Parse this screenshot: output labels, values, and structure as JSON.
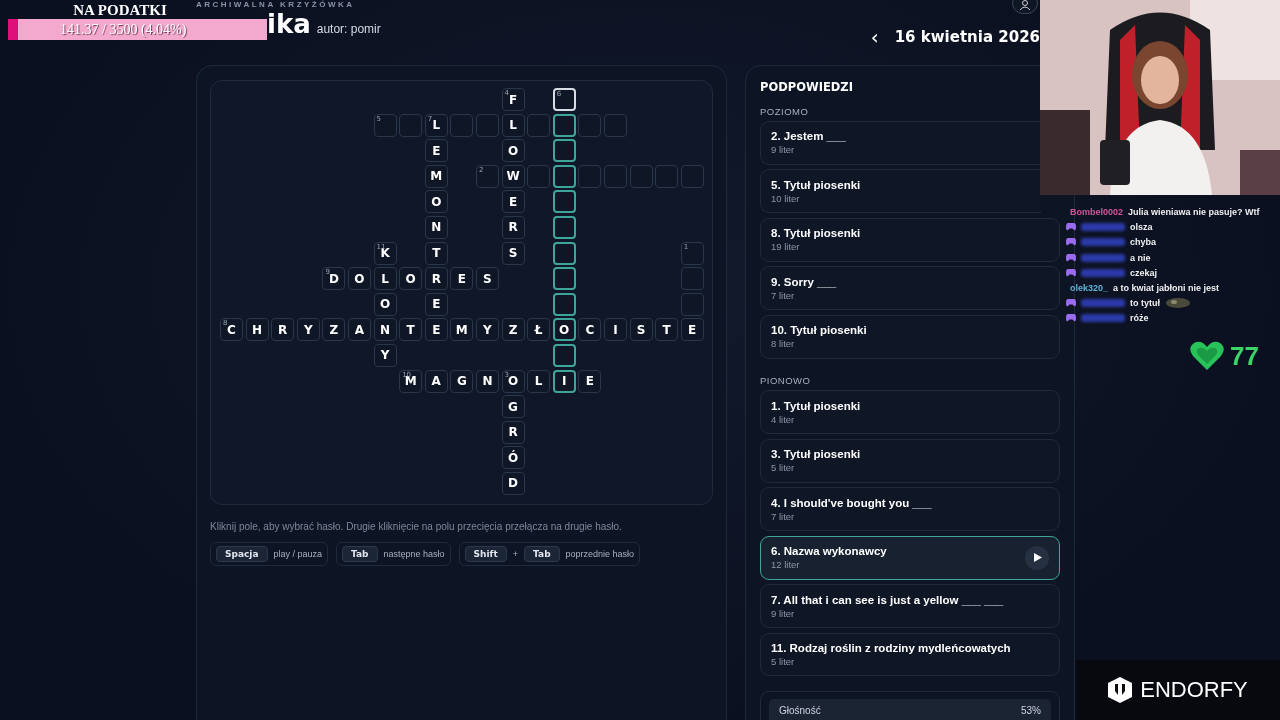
{
  "header": {
    "kicker": "ARCHIWALNA KRZYŻÓWKA",
    "title": "ika",
    "author": "autor: pomir",
    "date": "16 kwietnia 2026",
    "prev": "‹"
  },
  "donation": {
    "title": "NA PODATKI",
    "reading": "141.37 / 3500 (4.04%)",
    "level": 0.0404
  },
  "grid": {
    "rows": [
      {
        "cells": [
          {
            "kind": "gap"
          },
          {
            "kind": "gap"
          },
          {
            "kind": "gap"
          },
          {
            "kind": "gap"
          },
          {
            "kind": "gap"
          },
          {
            "kind": "gap"
          },
          {
            "kind": "gap"
          },
          {
            "kind": "gap"
          },
          {
            "kind": "gap"
          },
          {
            "kind": "gap"
          },
          {
            "kind": "gap"
          },
          {
            "kind": "cell",
            "letter": "F",
            "number": "4",
            "highlighted": false,
            "selected": false
          },
          {
            "kind": "gap"
          },
          {
            "kind": "cell",
            "number": "6",
            "highlighted": false,
            "selected": true
          }
        ]
      },
      {
        "cells": [
          {
            "kind": "gap"
          },
          {
            "kind": "gap"
          },
          {
            "kind": "gap"
          },
          {
            "kind": "gap"
          },
          {
            "kind": "gap"
          },
          {
            "kind": "gap"
          },
          {
            "kind": "cell",
            "number": "5",
            "highlighted": false,
            "selected": false
          },
          {
            "kind": "cell",
            "highlighted": false,
            "selected": false
          },
          {
            "kind": "cell",
            "letter": "L",
            "number": "7",
            "highlighted": false,
            "selected": false
          },
          {
            "kind": "cell",
            "highlighted": false,
            "selected": false
          },
          {
            "kind": "cell",
            "highlighted": false,
            "selected": false
          },
          {
            "kind": "cell",
            "letter": "L",
            "highlighted": false,
            "selected": false
          },
          {
            "kind": "cell",
            "highlighted": false,
            "selected": false
          },
          {
            "kind": "cell",
            "highlighted": true,
            "selected": false
          },
          {
            "kind": "cell",
            "highlighted": false,
            "selected": false
          },
          {
            "kind": "cell",
            "highlighted": false,
            "selected": false
          }
        ]
      },
      {
        "cells": [
          {
            "kind": "gap"
          },
          {
            "kind": "gap"
          },
          {
            "kind": "gap"
          },
          {
            "kind": "gap"
          },
          {
            "kind": "gap"
          },
          {
            "kind": "gap"
          },
          {
            "kind": "gap"
          },
          {
            "kind": "gap"
          },
          {
            "kind": "cell",
            "letter": "E",
            "highlighted": false,
            "selected": false
          },
          {
            "kind": "gap"
          },
          {
            "kind": "gap"
          },
          {
            "kind": "cell",
            "letter": "O",
            "highlighted": false,
            "selected": false
          },
          {
            "kind": "gap"
          },
          {
            "kind": "cell",
            "highlighted": true,
            "selected": false
          }
        ]
      },
      {
        "cells": [
          {
            "kind": "gap"
          },
          {
            "kind": "gap"
          },
          {
            "kind": "gap"
          },
          {
            "kind": "gap"
          },
          {
            "kind": "gap"
          },
          {
            "kind": "gap"
          },
          {
            "kind": "gap"
          },
          {
            "kind": "gap"
          },
          {
            "kind": "cell",
            "letter": "M",
            "highlighted": false,
            "selected": false
          },
          {
            "kind": "gap"
          },
          {
            "kind": "cell",
            "number": "2",
            "highlighted": false,
            "selected": false
          },
          {
            "kind": "cell",
            "letter": "W",
            "highlighted": false,
            "selected": false
          },
          {
            "kind": "cell",
            "highlighted": false,
            "selected": false
          },
          {
            "kind": "cell",
            "highlighted": true,
            "selected": false
          },
          {
            "kind": "cell",
            "highlighted": false,
            "selected": false
          },
          {
            "kind": "cell",
            "highlighted": false,
            "selected": false
          },
          {
            "kind": "cell",
            "highlighted": false,
            "selected": false
          },
          {
            "kind": "cell",
            "highlighted": false,
            "selected": false
          },
          {
            "kind": "cell",
            "highlighted": false,
            "selected": false
          }
        ]
      },
      {
        "cells": [
          {
            "kind": "gap"
          },
          {
            "kind": "gap"
          },
          {
            "kind": "gap"
          },
          {
            "kind": "gap"
          },
          {
            "kind": "gap"
          },
          {
            "kind": "gap"
          },
          {
            "kind": "gap"
          },
          {
            "kind": "gap"
          },
          {
            "kind": "cell",
            "letter": "O",
            "highlighted": false,
            "selected": false
          },
          {
            "kind": "gap"
          },
          {
            "kind": "gap"
          },
          {
            "kind": "cell",
            "letter": "E",
            "highlighted": false,
            "selected": false
          },
          {
            "kind": "gap"
          },
          {
            "kind": "cell",
            "highlighted": true,
            "selected": false
          }
        ]
      },
      {
        "cells": [
          {
            "kind": "gap"
          },
          {
            "kind": "gap"
          },
          {
            "kind": "gap"
          },
          {
            "kind": "gap"
          },
          {
            "kind": "gap"
          },
          {
            "kind": "gap"
          },
          {
            "kind": "gap"
          },
          {
            "kind": "gap"
          },
          {
            "kind": "cell",
            "letter": "N",
            "highlighted": false,
            "selected": false
          },
          {
            "kind": "gap"
          },
          {
            "kind": "gap"
          },
          {
            "kind": "cell",
            "letter": "R",
            "highlighted": false,
            "selected": false
          },
          {
            "kind": "gap"
          },
          {
            "kind": "cell",
            "highlighted": true,
            "selected": false
          }
        ]
      },
      {
        "cells": [
          {
            "kind": "gap"
          },
          {
            "kind": "gap"
          },
          {
            "kind": "gap"
          },
          {
            "kind": "gap"
          },
          {
            "kind": "gap"
          },
          {
            "kind": "gap"
          },
          {
            "kind": "cell",
            "letter": "K",
            "number": "11",
            "highlighted": false,
            "selected": false
          },
          {
            "kind": "gap"
          },
          {
            "kind": "cell",
            "letter": "T",
            "highlighted": false,
            "selected": false
          },
          {
            "kind": "gap"
          },
          {
            "kind": "gap"
          },
          {
            "kind": "cell",
            "letter": "S",
            "highlighted": false,
            "selected": false
          },
          {
            "kind": "gap"
          },
          {
            "kind": "cell",
            "highlighted": true,
            "selected": false
          },
          {
            "kind": "gap"
          },
          {
            "kind": "gap"
          },
          {
            "kind": "gap"
          },
          {
            "kind": "gap"
          },
          {
            "kind": "cell",
            "number": "1",
            "highlighted": false,
            "selected": false
          }
        ]
      },
      {
        "cells": [
          {
            "kind": "gap"
          },
          {
            "kind": "gap"
          },
          {
            "kind": "gap"
          },
          {
            "kind": "gap"
          },
          {
            "kind": "cell",
            "letter": "D",
            "number": "9",
            "highlighted": false,
            "selected": false
          },
          {
            "kind": "cell",
            "letter": "O",
            "highlighted": false,
            "selected": false
          },
          {
            "kind": "cell",
            "letter": "L",
            "highlighted": false,
            "selected": false
          },
          {
            "kind": "cell",
            "letter": "O",
            "highlighted": false,
            "selected": false
          },
          {
            "kind": "cell",
            "letter": "R",
            "highlighted": false,
            "selected": false
          },
          {
            "kind": "cell",
            "letter": "E",
            "highlighted": false,
            "selected": false
          },
          {
            "kind": "cell",
            "letter": "S",
            "highlighted": false,
            "selected": false
          },
          {
            "kind": "gap"
          },
          {
            "kind": "gap"
          },
          {
            "kind": "cell",
            "highlighted": true,
            "selected": false
          },
          {
            "kind": "gap"
          },
          {
            "kind": "gap"
          },
          {
            "kind": "gap"
          },
          {
            "kind": "gap"
          },
          {
            "kind": "cell",
            "highlighted": false,
            "selected": false
          }
        ]
      },
      {
        "cells": [
          {
            "kind": "gap"
          },
          {
            "kind": "gap"
          },
          {
            "kind": "gap"
          },
          {
            "kind": "gap"
          },
          {
            "kind": "gap"
          },
          {
            "kind": "gap"
          },
          {
            "kind": "cell",
            "letter": "O",
            "highlighted": false,
            "selected": false
          },
          {
            "kind": "gap"
          },
          {
            "kind": "cell",
            "letter": "E",
            "highlighted": false,
            "selected": false
          },
          {
            "kind": "gap"
          },
          {
            "kind": "gap"
          },
          {
            "kind": "gap"
          },
          {
            "kind": "gap"
          },
          {
            "kind": "cell",
            "highlighted": true,
            "selected": false
          },
          {
            "kind": "gap"
          },
          {
            "kind": "gap"
          },
          {
            "kind": "gap"
          },
          {
            "kind": "gap"
          },
          {
            "kind": "cell",
            "highlighted": false,
            "selected": false
          }
        ]
      },
      {
        "cells": [
          {
            "kind": "cell",
            "letter": "C",
            "number": "8",
            "highlighted": false,
            "selected": false
          },
          {
            "kind": "cell",
            "letter": "H",
            "highlighted": false,
            "selected": false
          },
          {
            "kind": "cell",
            "letter": "R",
            "highlighted": false,
            "selected": false
          },
          {
            "kind": "cell",
            "letter": "Y",
            "highlighted": false,
            "selected": false
          },
          {
            "kind": "cell",
            "letter": "Z",
            "highlighted": false,
            "selected": false
          },
          {
            "kind": "cell",
            "letter": "A",
            "highlighted": false,
            "selected": false
          },
          {
            "kind": "cell",
            "letter": "N",
            "highlighted": false,
            "selected": false
          },
          {
            "kind": "cell",
            "letter": "T",
            "highlighted": false,
            "selected": false
          },
          {
            "kind": "cell",
            "letter": "E",
            "highlighted": false,
            "selected": false
          },
          {
            "kind": "cell",
            "letter": "M",
            "highlighted": false,
            "selected": false
          },
          {
            "kind": "cell",
            "letter": "Y",
            "highlighted": false,
            "selected": false
          },
          {
            "kind": "cell",
            "letter": "Z",
            "highlighted": false,
            "selected": false
          },
          {
            "kind": "cell",
            "letter": "Ł",
            "highlighted": false,
            "selected": false
          },
          {
            "kind": "cell",
            "letter": "O",
            "highlighted": true,
            "selected": false
          },
          {
            "kind": "cell",
            "letter": "C",
            "highlighted": false,
            "selected": false
          },
          {
            "kind": "cell",
            "letter": "I",
            "highlighted": false,
            "selected": false
          },
          {
            "kind": "cell",
            "letter": "S",
            "highlighted": false,
            "selected": false
          },
          {
            "kind": "cell",
            "letter": "T",
            "highlighted": false,
            "selected": false
          },
          {
            "kind": "cell",
            "letter": "E",
            "highlighted": false,
            "selected": false
          }
        ]
      },
      {
        "cells": [
          {
            "kind": "gap"
          },
          {
            "kind": "gap"
          },
          {
            "kind": "gap"
          },
          {
            "kind": "gap"
          },
          {
            "kind": "gap"
          },
          {
            "kind": "gap"
          },
          {
            "kind": "cell",
            "letter": "Y",
            "highlighted": false,
            "selected": false
          },
          {
            "kind": "gap"
          },
          {
            "kind": "gap"
          },
          {
            "kind": "gap"
          },
          {
            "kind": "gap"
          },
          {
            "kind": "gap"
          },
          {
            "kind": "gap"
          },
          {
            "kind": "cell",
            "highlighted": true,
            "selected": false
          }
        ]
      },
      {
        "cells": [
          {
            "kind": "gap"
          },
          {
            "kind": "gap"
          },
          {
            "kind": "gap"
          },
          {
            "kind": "gap"
          },
          {
            "kind": "gap"
          },
          {
            "kind": "gap"
          },
          {
            "kind": "gap"
          },
          {
            "kind": "cell",
            "letter": "M",
            "number": "10",
            "highlighted": false,
            "selected": false
          },
          {
            "kind": "cell",
            "letter": "A",
            "highlighted": false,
            "selected": false
          },
          {
            "kind": "cell",
            "letter": "G",
            "highlighted": false,
            "selected": false
          },
          {
            "kind": "cell",
            "letter": "N",
            "highlighted": false,
            "selected": false
          },
          {
            "kind": "cell",
            "letter": "O",
            "number": "3",
            "highlighted": false,
            "selected": false
          },
          {
            "kind": "cell",
            "letter": "L",
            "highlighted": false,
            "selected": false
          },
          {
            "kind": "cell",
            "letter": "I",
            "highlighted": true,
            "selected": false
          },
          {
            "kind": "cell",
            "letter": "E",
            "highlighted": false,
            "selected": false
          }
        ]
      },
      {
        "cells": [
          {
            "kind": "gap"
          },
          {
            "kind": "gap"
          },
          {
            "kind": "gap"
          },
          {
            "kind": "gap"
          },
          {
            "kind": "gap"
          },
          {
            "kind": "gap"
          },
          {
            "kind": "gap"
          },
          {
            "kind": "gap"
          },
          {
            "kind": "gap"
          },
          {
            "kind": "gap"
          },
          {
            "kind": "gap"
          },
          {
            "kind": "cell",
            "letter": "G",
            "highlighted": false,
            "selected": false
          }
        ]
      },
      {
        "cells": [
          {
            "kind": "gap"
          },
          {
            "kind": "gap"
          },
          {
            "kind": "gap"
          },
          {
            "kind": "gap"
          },
          {
            "kind": "gap"
          },
          {
            "kind": "gap"
          },
          {
            "kind": "gap"
          },
          {
            "kind": "gap"
          },
          {
            "kind": "gap"
          },
          {
            "kind": "gap"
          },
          {
            "kind": "gap"
          },
          {
            "kind": "cell",
            "letter": "R",
            "highlighted": false,
            "selected": false
          }
        ]
      },
      {
        "cells": [
          {
            "kind": "gap"
          },
          {
            "kind": "gap"
          },
          {
            "kind": "gap"
          },
          {
            "kind": "gap"
          },
          {
            "kind": "gap"
          },
          {
            "kind": "gap"
          },
          {
            "kind": "gap"
          },
          {
            "kind": "gap"
          },
          {
            "kind": "gap"
          },
          {
            "kind": "gap"
          },
          {
            "kind": "gap"
          },
          {
            "kind": "cell",
            "letter": "Ó",
            "highlighted": false,
            "selected": false
          }
        ]
      },
      {
        "cells": [
          {
            "kind": "gap"
          },
          {
            "kind": "gap"
          },
          {
            "kind": "gap"
          },
          {
            "kind": "gap"
          },
          {
            "kind": "gap"
          },
          {
            "kind": "gap"
          },
          {
            "kind": "gap"
          },
          {
            "kind": "gap"
          },
          {
            "kind": "gap"
          },
          {
            "kind": "gap"
          },
          {
            "kind": "gap"
          },
          {
            "kind": "cell",
            "letter": "D",
            "highlighted": false,
            "selected": false
          }
        ]
      }
    ]
  },
  "help": "Kliknij pole, aby wybrać hasło. Drugie kliknięcie na polu przecięcia przełącza na drugie hasło.",
  "shortcuts": [
    {
      "keys": [
        "Spacja"
      ],
      "text": "play / pauza"
    },
    {
      "keys": [
        "Tab"
      ],
      "text": "następne hasło"
    },
    {
      "keys": [
        "Shift",
        "Tab"
      ],
      "joiner": "+",
      "text": "poprzednie hasło"
    }
  ],
  "hints": {
    "title": "PODPOWIEDZI",
    "sections": [
      {
        "title": "POZIOMO",
        "items": [
          {
            "label": "2. Jestem ___",
            "count": "9 liter",
            "selected": false
          },
          {
            "label": "5. Tytuł piosenki",
            "count": "10 liter",
            "selected": false
          },
          {
            "label": "8. Tytuł piosenki",
            "count": "19 liter",
            "selected": false
          },
          {
            "label": "9. Sorry ___",
            "count": "7 liter",
            "selected": false
          },
          {
            "label": "10. Tytuł piosenki",
            "count": "8 liter",
            "selected": false
          }
        ]
      },
      {
        "title": "PIONOWO",
        "items": [
          {
            "label": "1. Tytuł piosenki",
            "count": "4 liter",
            "selected": false
          },
          {
            "label": "3. Tytuł piosenki",
            "count": "5 liter",
            "selected": false
          },
          {
            "label": "4. I should've bought you ___",
            "count": "7 liter",
            "selected": false
          },
          {
            "label": "6. Nazwa wykonawcy",
            "count": "12 liter",
            "selected": true
          },
          {
            "label": "7. All that i can see is just a yellow ___ ___",
            "count": "9 liter",
            "selected": false
          },
          {
            "label": "11. Rodzaj roślin z rodziny mydleńcowatych",
            "count": "5 liter",
            "selected": false
          }
        ]
      }
    ]
  },
  "volume": {
    "label": "Głośność",
    "reading": "53%"
  },
  "chat": {
    "messages": [
      {
        "kind": "named",
        "user": "Bombel0002",
        "color": "#d0559a",
        "text": "Julia wieniawa nie pasuje? Wtf",
        "emote": false
      },
      {
        "kind": "blurred",
        "text": "olsza",
        "emote": false
      },
      {
        "kind": "blurred",
        "text": "chyba",
        "emote": false
      },
      {
        "kind": "blurred",
        "text": "a nie",
        "emote": false
      },
      {
        "kind": "blurred",
        "text": "czekaj",
        "emote": false
      },
      {
        "kind": "named",
        "user": "olek320_",
        "color": "#5ab4d6",
        "text": "a to kwiat jabłoni nie jest",
        "emote": false
      },
      {
        "kind": "blurred",
        "text": "to tytuł",
        "emote": true
      },
      {
        "kind": "blurred",
        "text": "róże",
        "emote": false
      }
    ],
    "hearts": "77"
  },
  "sponsor": "ENDORFY"
}
